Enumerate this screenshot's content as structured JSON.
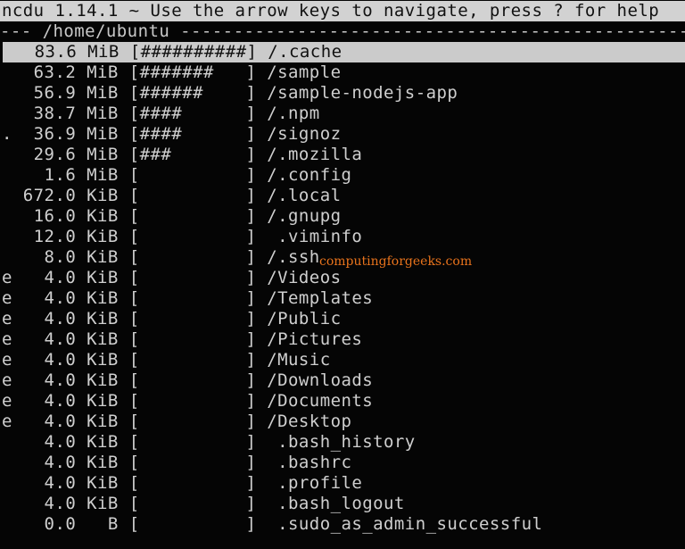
{
  "title": "ncdu 1.14.1 ~ Use the arrow keys to navigate, press ? for help",
  "path": "/home/ubuntu",
  "selected_index": 0,
  "watermark": "computingforgeeks.com",
  "colors": {
    "background": "#050505",
    "text": "#cfcfcf",
    "title_bg": "#d2d2d2",
    "selected_bg": "#cbcbcb",
    "watermark": "#e8731c"
  },
  "rows": [
    {
      "flag": "",
      "size": "83.6",
      "unit": "MiB",
      "bar": "##########",
      "name": "/.cache"
    },
    {
      "flag": "",
      "size": "63.2",
      "unit": "MiB",
      "bar": "#######",
      "name": "/sample"
    },
    {
      "flag": "",
      "size": "56.9",
      "unit": "MiB",
      "bar": "######",
      "name": "/sample-nodejs-app"
    },
    {
      "flag": "",
      "size": "38.7",
      "unit": "MiB",
      "bar": "####",
      "name": "/.npm"
    },
    {
      "flag": ".",
      "size": "36.9",
      "unit": "MiB",
      "bar": "####",
      "name": "/signoz"
    },
    {
      "flag": "",
      "size": "29.6",
      "unit": "MiB",
      "bar": "###",
      "name": "/.mozilla"
    },
    {
      "flag": "",
      "size": "1.6",
      "unit": "MiB",
      "bar": "",
      "name": "/.config"
    },
    {
      "flag": "",
      "size": "672.0",
      "unit": "KiB",
      "bar": "",
      "name": "/.local"
    },
    {
      "flag": "",
      "size": "16.0",
      "unit": "KiB",
      "bar": "",
      "name": "/.gnupg"
    },
    {
      "flag": "",
      "size": "12.0",
      "unit": "KiB",
      "bar": "",
      "name": " .viminfo"
    },
    {
      "flag": "",
      "size": "8.0",
      "unit": "KiB",
      "bar": "",
      "name": "/.ssh"
    },
    {
      "flag": "e",
      "size": "4.0",
      "unit": "KiB",
      "bar": "",
      "name": "/Videos"
    },
    {
      "flag": "e",
      "size": "4.0",
      "unit": "KiB",
      "bar": "",
      "name": "/Templates"
    },
    {
      "flag": "e",
      "size": "4.0",
      "unit": "KiB",
      "bar": "",
      "name": "/Public"
    },
    {
      "flag": "e",
      "size": "4.0",
      "unit": "KiB",
      "bar": "",
      "name": "/Pictures"
    },
    {
      "flag": "e",
      "size": "4.0",
      "unit": "KiB",
      "bar": "",
      "name": "/Music"
    },
    {
      "flag": "e",
      "size": "4.0",
      "unit": "KiB",
      "bar": "",
      "name": "/Downloads"
    },
    {
      "flag": "e",
      "size": "4.0",
      "unit": "KiB",
      "bar": "",
      "name": "/Documents"
    },
    {
      "flag": "e",
      "size": "4.0",
      "unit": "KiB",
      "bar": "",
      "name": "/Desktop"
    },
    {
      "flag": "",
      "size": "4.0",
      "unit": "KiB",
      "bar": "",
      "name": " .bash_history"
    },
    {
      "flag": "",
      "size": "4.0",
      "unit": "KiB",
      "bar": "",
      "name": " .bashrc"
    },
    {
      "flag": "",
      "size": "4.0",
      "unit": "KiB",
      "bar": "",
      "name": " .profile"
    },
    {
      "flag": "",
      "size": "4.0",
      "unit": "KiB",
      "bar": "",
      "name": " .bash_logout"
    },
    {
      "flag": "",
      "size": "0.0",
      "unit": "B",
      "bar": "",
      "name": " .sudo_as_admin_successful"
    }
  ]
}
